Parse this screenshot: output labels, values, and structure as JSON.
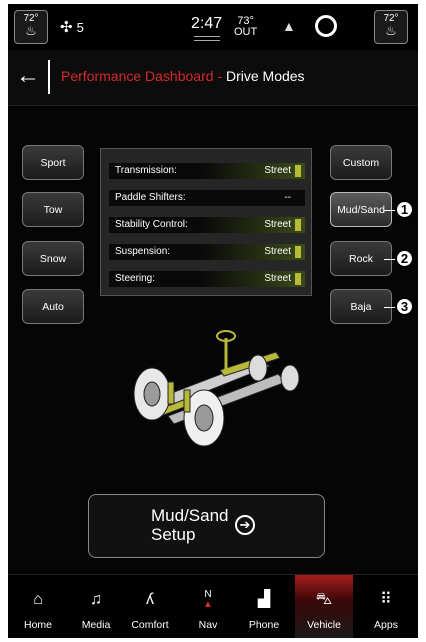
{
  "status": {
    "driver_temp": "72°",
    "fan_speed": "5",
    "time": "2:47",
    "outside_temp": "73°",
    "outside_label": "OUT",
    "passenger_temp": "72°",
    "icons": [
      "heated-seat-icon",
      "fan-icon",
      "profile-icon",
      "voice-ring-icon",
      "heated-seat-icon"
    ]
  },
  "header": {
    "crumb": "Performance Dashboard -",
    "page": "Drive Modes"
  },
  "modes_left": [
    "Sport",
    "Tow",
    "Snow",
    "Auto"
  ],
  "modes_right": [
    "Custom",
    "Mud/Sand",
    "Rock",
    "Baja"
  ],
  "selected_mode": "Mud/Sand",
  "settings": [
    {
      "label": "Transmission:",
      "value": "Street"
    },
    {
      "label": "Paddle Shifters:",
      "value": "--"
    },
    {
      "label": "Stability Control:",
      "value": "Street"
    },
    {
      "label": "Suspension:",
      "value": "Street"
    },
    {
      "label": "Steering:",
      "value": "Street"
    }
  ],
  "callouts": [
    "1",
    "2",
    "3"
  ],
  "setup_button": {
    "label": "Mud/Sand\nSetup"
  },
  "nav": [
    {
      "label": "Home",
      "icon": "home-icon"
    },
    {
      "label": "Media",
      "icon": "music-note-icon"
    },
    {
      "label": "Comfort",
      "icon": "seat-icon"
    },
    {
      "label": "Nav",
      "icon": "compass-icon",
      "compass_letter": "N"
    },
    {
      "label": "Phone",
      "icon": "phone-signal-icon"
    },
    {
      "label": "Vehicle",
      "icon": "car-icon"
    },
    {
      "label": "Apps",
      "icon": "grid-icon"
    }
  ],
  "active_nav": "Vehicle",
  "colors": {
    "accent_red": "#d42a2a",
    "setting_bar": "#b6bc3a",
    "chassis_highlight": "#b8b83a"
  }
}
